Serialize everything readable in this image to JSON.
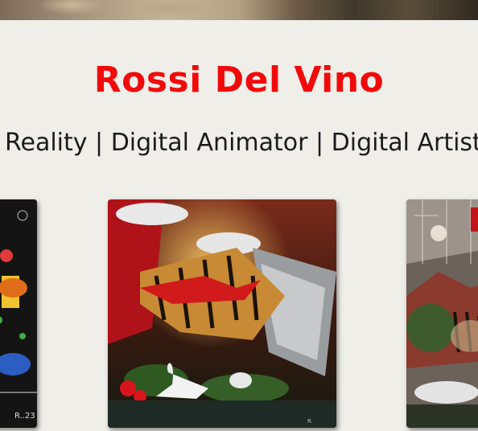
{
  "artist": {
    "name": "Rossi Del Vino",
    "roles_line": "Reality | Digital Animator | Digital Artist |"
  },
  "gallery": {
    "items": [
      {
        "label": "artwork-left-partial"
      },
      {
        "label": "artwork-tiger-swan"
      },
      {
        "label": "artwork-right-partial"
      }
    ]
  },
  "colors": {
    "background": "#efeee9",
    "title": "#f20a0a",
    "text": "#1b1b1b"
  }
}
